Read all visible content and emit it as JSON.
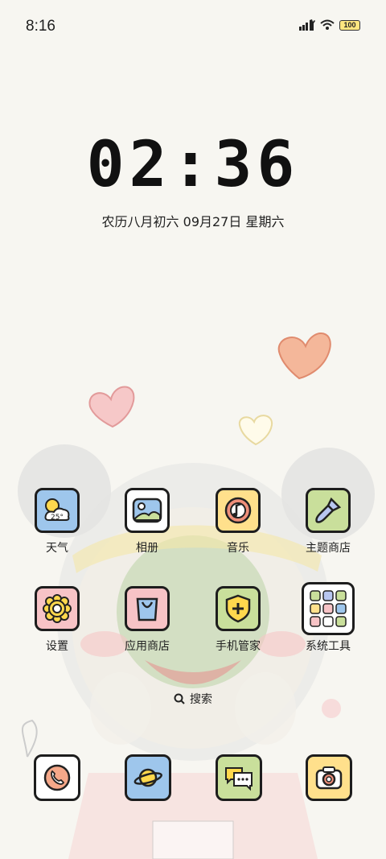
{
  "status_bar": {
    "time": "8:16",
    "battery": "100"
  },
  "lockclock": {
    "time": "02:36",
    "date": "农历八月初六  09月27日  星期六"
  },
  "apps_row1": [
    {
      "label": "天气",
      "icon": "weather-icon",
      "color": "#9ec6ec",
      "temp": "25°"
    },
    {
      "label": "相册",
      "icon": "gallery-icon",
      "color": "#ffffff"
    },
    {
      "label": "音乐",
      "icon": "music-icon",
      "color": "#ffe08c"
    },
    {
      "label": "主题商店",
      "icon": "theme-brush-icon",
      "color": "#c9df9b"
    }
  ],
  "apps_row2": [
    {
      "label": "设置",
      "icon": "settings-gear-icon",
      "color": "#f7c3c6"
    },
    {
      "label": "应用商店",
      "icon": "app-store-bag-icon",
      "color": "#f7c3c6"
    },
    {
      "label": "手机管家",
      "icon": "phone-manager-shield-icon",
      "color": "#c9df9b"
    },
    {
      "label": "系统工具",
      "icon": "system-tools-folder-icon",
      "color": "#ffffff"
    }
  ],
  "search": {
    "label": "搜索"
  },
  "dock": [
    {
      "icon": "phone-icon",
      "color": "#ffffff"
    },
    {
      "icon": "browser-planet-icon",
      "color": "#9ec6ec"
    },
    {
      "icon": "messages-icon",
      "color": "#c9df9b"
    },
    {
      "icon": "camera-icon",
      "color": "#ffe08c"
    }
  ]
}
